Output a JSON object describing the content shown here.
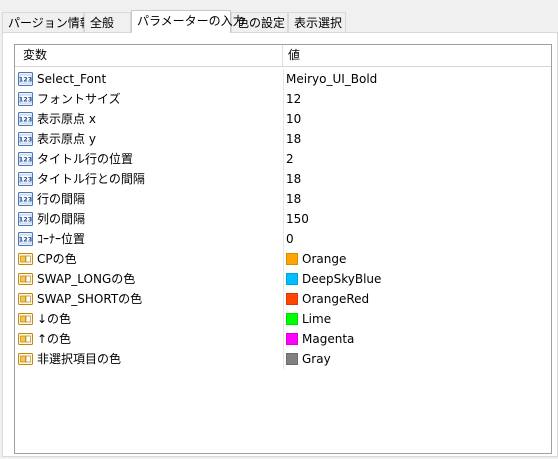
{
  "tabs": [
    {
      "label": "パージョン情報",
      "active": false
    },
    {
      "label": "全般",
      "active": false
    },
    {
      "label": "パラメーターの入力",
      "active": true
    },
    {
      "label": "色の設定",
      "active": false
    },
    {
      "label": "表示選択",
      "active": false
    }
  ],
  "grid": {
    "headers": {
      "variable": "変数",
      "value": "値"
    },
    "rows": [
      {
        "name": "Select_Font",
        "value": "Meiryo_UI_Bold",
        "icon": "number-icon"
      },
      {
        "name": "フォントサイズ",
        "value": "12",
        "icon": "number-icon"
      },
      {
        "name": "表示原点 x",
        "value": "10",
        "icon": "number-icon"
      },
      {
        "name": "表示原点 y",
        "value": "18",
        "icon": "number-icon"
      },
      {
        "name": "タイトル行の位置",
        "value": "2",
        "icon": "number-icon"
      },
      {
        "name": "タイトル行との間隔",
        "value": "18",
        "icon": "number-icon"
      },
      {
        "name": "行の間隔",
        "value": "18",
        "icon": "number-icon"
      },
      {
        "name": "列の間隔",
        "value": "150",
        "icon": "number-icon"
      },
      {
        "name": "ｺｰﾅｰ位置",
        "value": "0",
        "icon": "number-icon"
      },
      {
        "name": "CPの色",
        "value": "Orange",
        "icon": "color-param-icon",
        "color": "#FFA500"
      },
      {
        "name": "SWAP_LONGの色",
        "value": "DeepSkyBlue",
        "icon": "color-param-icon",
        "color": "#00BFFF"
      },
      {
        "name": "SWAP_SHORTの色",
        "value": "OrangeRed",
        "icon": "color-param-icon",
        "color": "#FF4500"
      },
      {
        "name": "↓の色",
        "value": "Lime",
        "icon": "color-param-icon",
        "color": "#00FF00"
      },
      {
        "name": "↑の色",
        "value": "Magenta",
        "icon": "color-param-icon",
        "color": "#FF00FF"
      },
      {
        "name": "非選択項目の色",
        "value": "Gray",
        "icon": "color-param-icon",
        "color": "#808080"
      }
    ]
  }
}
